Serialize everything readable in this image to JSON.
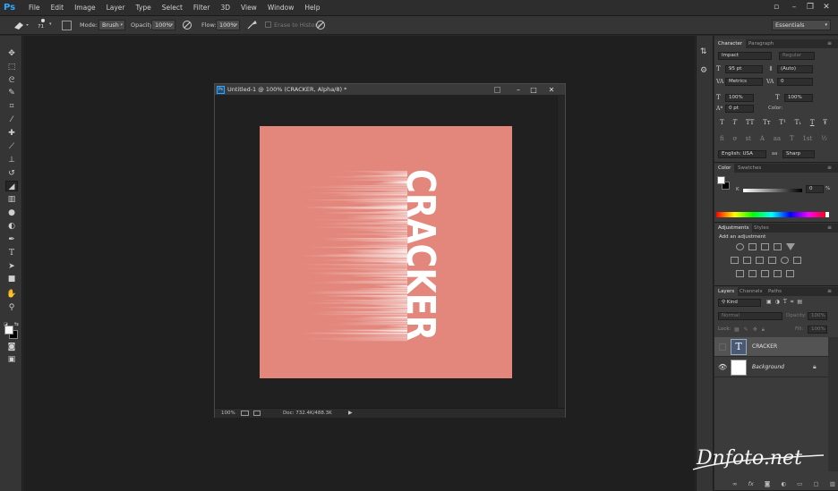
{
  "app": {
    "logo": "Ps"
  },
  "menu": [
    "File",
    "Edit",
    "Image",
    "Layer",
    "Type",
    "Select",
    "Filter",
    "3D",
    "View",
    "Window",
    "Help"
  ],
  "window_controls": {
    "minimize": "–",
    "restore": "❐",
    "close": "✕"
  },
  "options_bar": {
    "brush_size": "71",
    "mode_label": "Mode:",
    "mode_value": "Brush",
    "opacity_label": "Opacity:",
    "opacity_value": "100%",
    "flow_label": "Flow:",
    "flow_value": "100%",
    "erase_history_label": "Erase to History",
    "workspace_value": "Essentials"
  },
  "document": {
    "title": "Untitled-1 @ 100% (CRACKER, Alpha/8) *",
    "icon_label": "Ps",
    "canvas_text": "CRACKER",
    "zoom": "100%",
    "doc_info": "Doc: 732.4K/488.3K",
    "controls": {
      "minimize": "–",
      "maximize": "□",
      "close": "✕"
    }
  },
  "character_panel": {
    "tabs": [
      "Character",
      "Paragraph"
    ],
    "font_family": "Impact",
    "font_style": "Regular",
    "font_size": "95 pt",
    "leading": "(Auto)",
    "kerning": "Metrics",
    "tracking": "0",
    "vertical_scale": "100%",
    "horizontal_scale": "100%",
    "baseline_shift": "0 pt",
    "color_label": "Color:",
    "style_buttons": [
      "T",
      "T",
      "TT",
      "Tт",
      "T¹",
      "T₁",
      "T",
      "Ŧ"
    ],
    "opentype_buttons": [
      "fi",
      "ơ",
      "st",
      "A",
      "aa",
      "T",
      "1st",
      "½"
    ],
    "language": "English: USA",
    "aa_label": "aa",
    "antialias": "Sharp"
  },
  "color_panel": {
    "tabs": [
      "Color",
      "Swatches"
    ],
    "channel_label": "K",
    "value": "0",
    "unit": "%"
  },
  "adjustments_panel": {
    "tabs": [
      "Adjustments",
      "Styles"
    ],
    "subtitle": "Add an adjustment"
  },
  "layers_panel": {
    "tabs": [
      "Layers",
      "Channels",
      "Paths"
    ],
    "filter_kind": "Kind",
    "blend_mode": "Normal",
    "opacity_label": "Opacity:",
    "opacity_value": "100%",
    "lock_label": "Lock:",
    "fill_label": "Fill:",
    "fill_value": "100%",
    "layers": [
      {
        "name": "CRACKER",
        "thumb": "T",
        "visible": false,
        "locked": false
      },
      {
        "name": "Background",
        "thumb": "",
        "visible": true,
        "locked": true
      }
    ],
    "footer_icons": [
      "link-icon",
      "fx-icon",
      "mask-icon",
      "adjustment-icon",
      "group-icon",
      "new-layer-icon",
      "trash-icon"
    ]
  },
  "watermark": {
    "text": "Dnfoto.net"
  },
  "colors": {
    "canvas": "#e3877c",
    "accent": "#31a8ff",
    "panel": "#353535",
    "workspace": "#1f1f1f"
  }
}
